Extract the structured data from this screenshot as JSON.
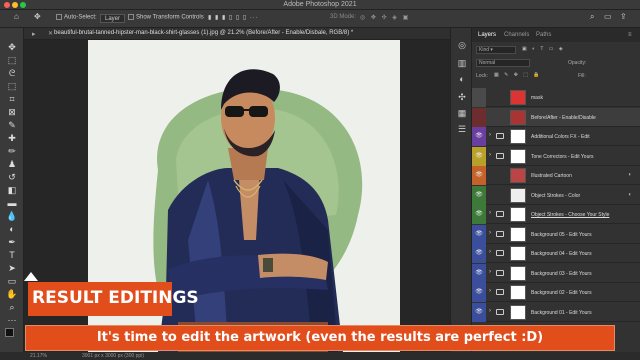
{
  "app": {
    "title": "Adobe Photoshop 2021"
  },
  "options_bar": {
    "auto_select_label": "Auto-Select:",
    "auto_select_value": "Layer",
    "show_transform_label": "Show Transform Controls",
    "mode_label": "3D Mode:"
  },
  "document": {
    "tab_title": "beautiful-brutal-tanned-hipster-man-black-shirt-glasses (1).jpg @ 21.2% (Before/After - Enable/Disbale, RGB/8) *"
  },
  "layers_panel": {
    "tabs": [
      {
        "label": "Layers",
        "active": true
      },
      {
        "label": "Channels",
        "active": false
      },
      {
        "label": "Paths",
        "active": false
      }
    ],
    "kind_label": "Kind",
    "blend_mode": "Normal",
    "opacity_label": "Opacity:",
    "lock_label": "Lock:",
    "fill_label": "Fill:",
    "layers": [
      {
        "name": "mask",
        "color": "#4a4a4a",
        "visible": false,
        "type": "image",
        "thumb": "#d33"
      },
      {
        "name": "Before/After - Enable/Disable",
        "color": "#6b2d2d",
        "visible": false,
        "type": "image",
        "thumb": "#a33"
      },
      {
        "name": "Additional Colors FX - Edit",
        "color": "#6a3da0",
        "visible": true,
        "type": "folder"
      },
      {
        "name": "Tone Correctors - Edit Yours",
        "color": "#b8a12a",
        "visible": true,
        "type": "folder"
      },
      {
        "name": "Illustrated Cartoon",
        "color": "#c4622a",
        "visible": true,
        "type": "image",
        "thumb": "#b44"
      },
      {
        "name": "Object Strokes - Color",
        "color": "#3d7a3a",
        "visible": true,
        "type": "image",
        "thumb": "#eee"
      },
      {
        "name": "Object Strokes - Choose Your Style",
        "color": "#3d7a3a",
        "visible": true,
        "type": "folder",
        "underlined": true
      },
      {
        "name": "Background 05 - Edit Yours",
        "color": "#3b4e9c",
        "visible": true,
        "type": "folder"
      },
      {
        "name": "Background 04 - Edit Yours",
        "color": "#3b4e9c",
        "visible": true,
        "type": "folder"
      },
      {
        "name": "Background 03 - Edit Yours",
        "color": "#3b4e9c",
        "visible": true,
        "type": "folder"
      },
      {
        "name": "Background 02 - Edit Yours",
        "color": "#3b4e9c",
        "visible": true,
        "type": "folder"
      },
      {
        "name": "Background 01 - Edit Yours",
        "color": "#3b4e9c",
        "visible": true,
        "type": "folder"
      }
    ]
  },
  "status_bar": {
    "zoom": "21.17%",
    "doc_size": "3001 px x 3000 px (300 ppi)"
  },
  "overlay": {
    "result_label": "RESULT EDITINGS",
    "caption": "It's time to edit the artwork (even the results are perfect :D)"
  },
  "colors": {
    "accent_orange": "#e24d1c",
    "panel_bg": "#323232"
  }
}
